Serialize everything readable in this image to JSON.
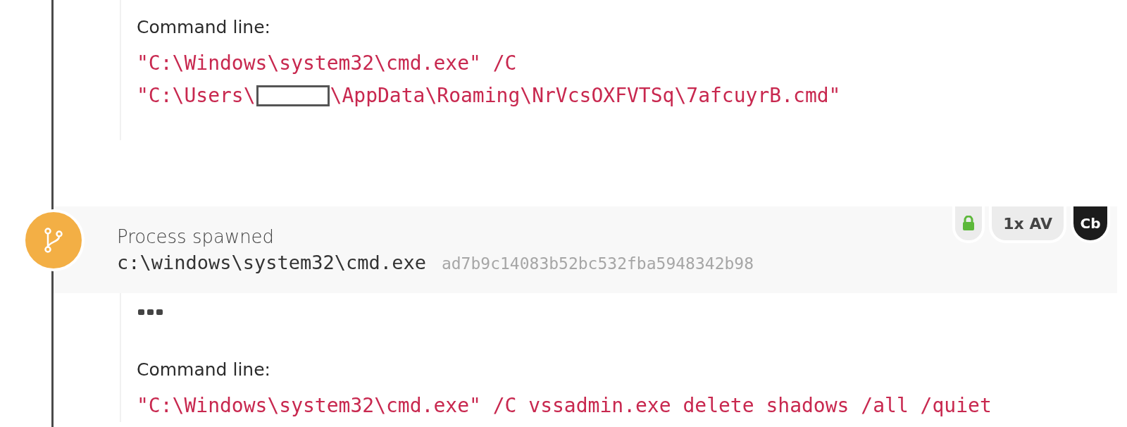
{
  "top_detail": {
    "label": "Command line:",
    "lines": [
      {
        "parts": [
          "\"C:\\Windows\\system32\\cmd.exe\" /C"
        ]
      },
      {
        "parts": [
          "\"C:\\Users\\",
          "\\AppData\\Roaming\\NrVcsOXFVTSq\\7afcuyrB.cmd\""
        ]
      }
    ]
  },
  "event": {
    "title": "Process spawned",
    "path": "c:\\windows\\system32\\cmd.exe",
    "hash": "ad7b9c14083b52bc532fba5948342b98",
    "badges": [
      {
        "kind": "lock"
      },
      {
        "kind": "pill",
        "label": "1x AV"
      },
      {
        "kind": "shield",
        "label": "Cb"
      }
    ]
  },
  "event_detail": {
    "more": true,
    "label": "Command line:",
    "lines": [
      {
        "parts": [
          "\"C:\\Windows\\system32\\cmd.exe\" /C vssadmin.exe delete shadows /all /quiet"
        ]
      }
    ]
  }
}
